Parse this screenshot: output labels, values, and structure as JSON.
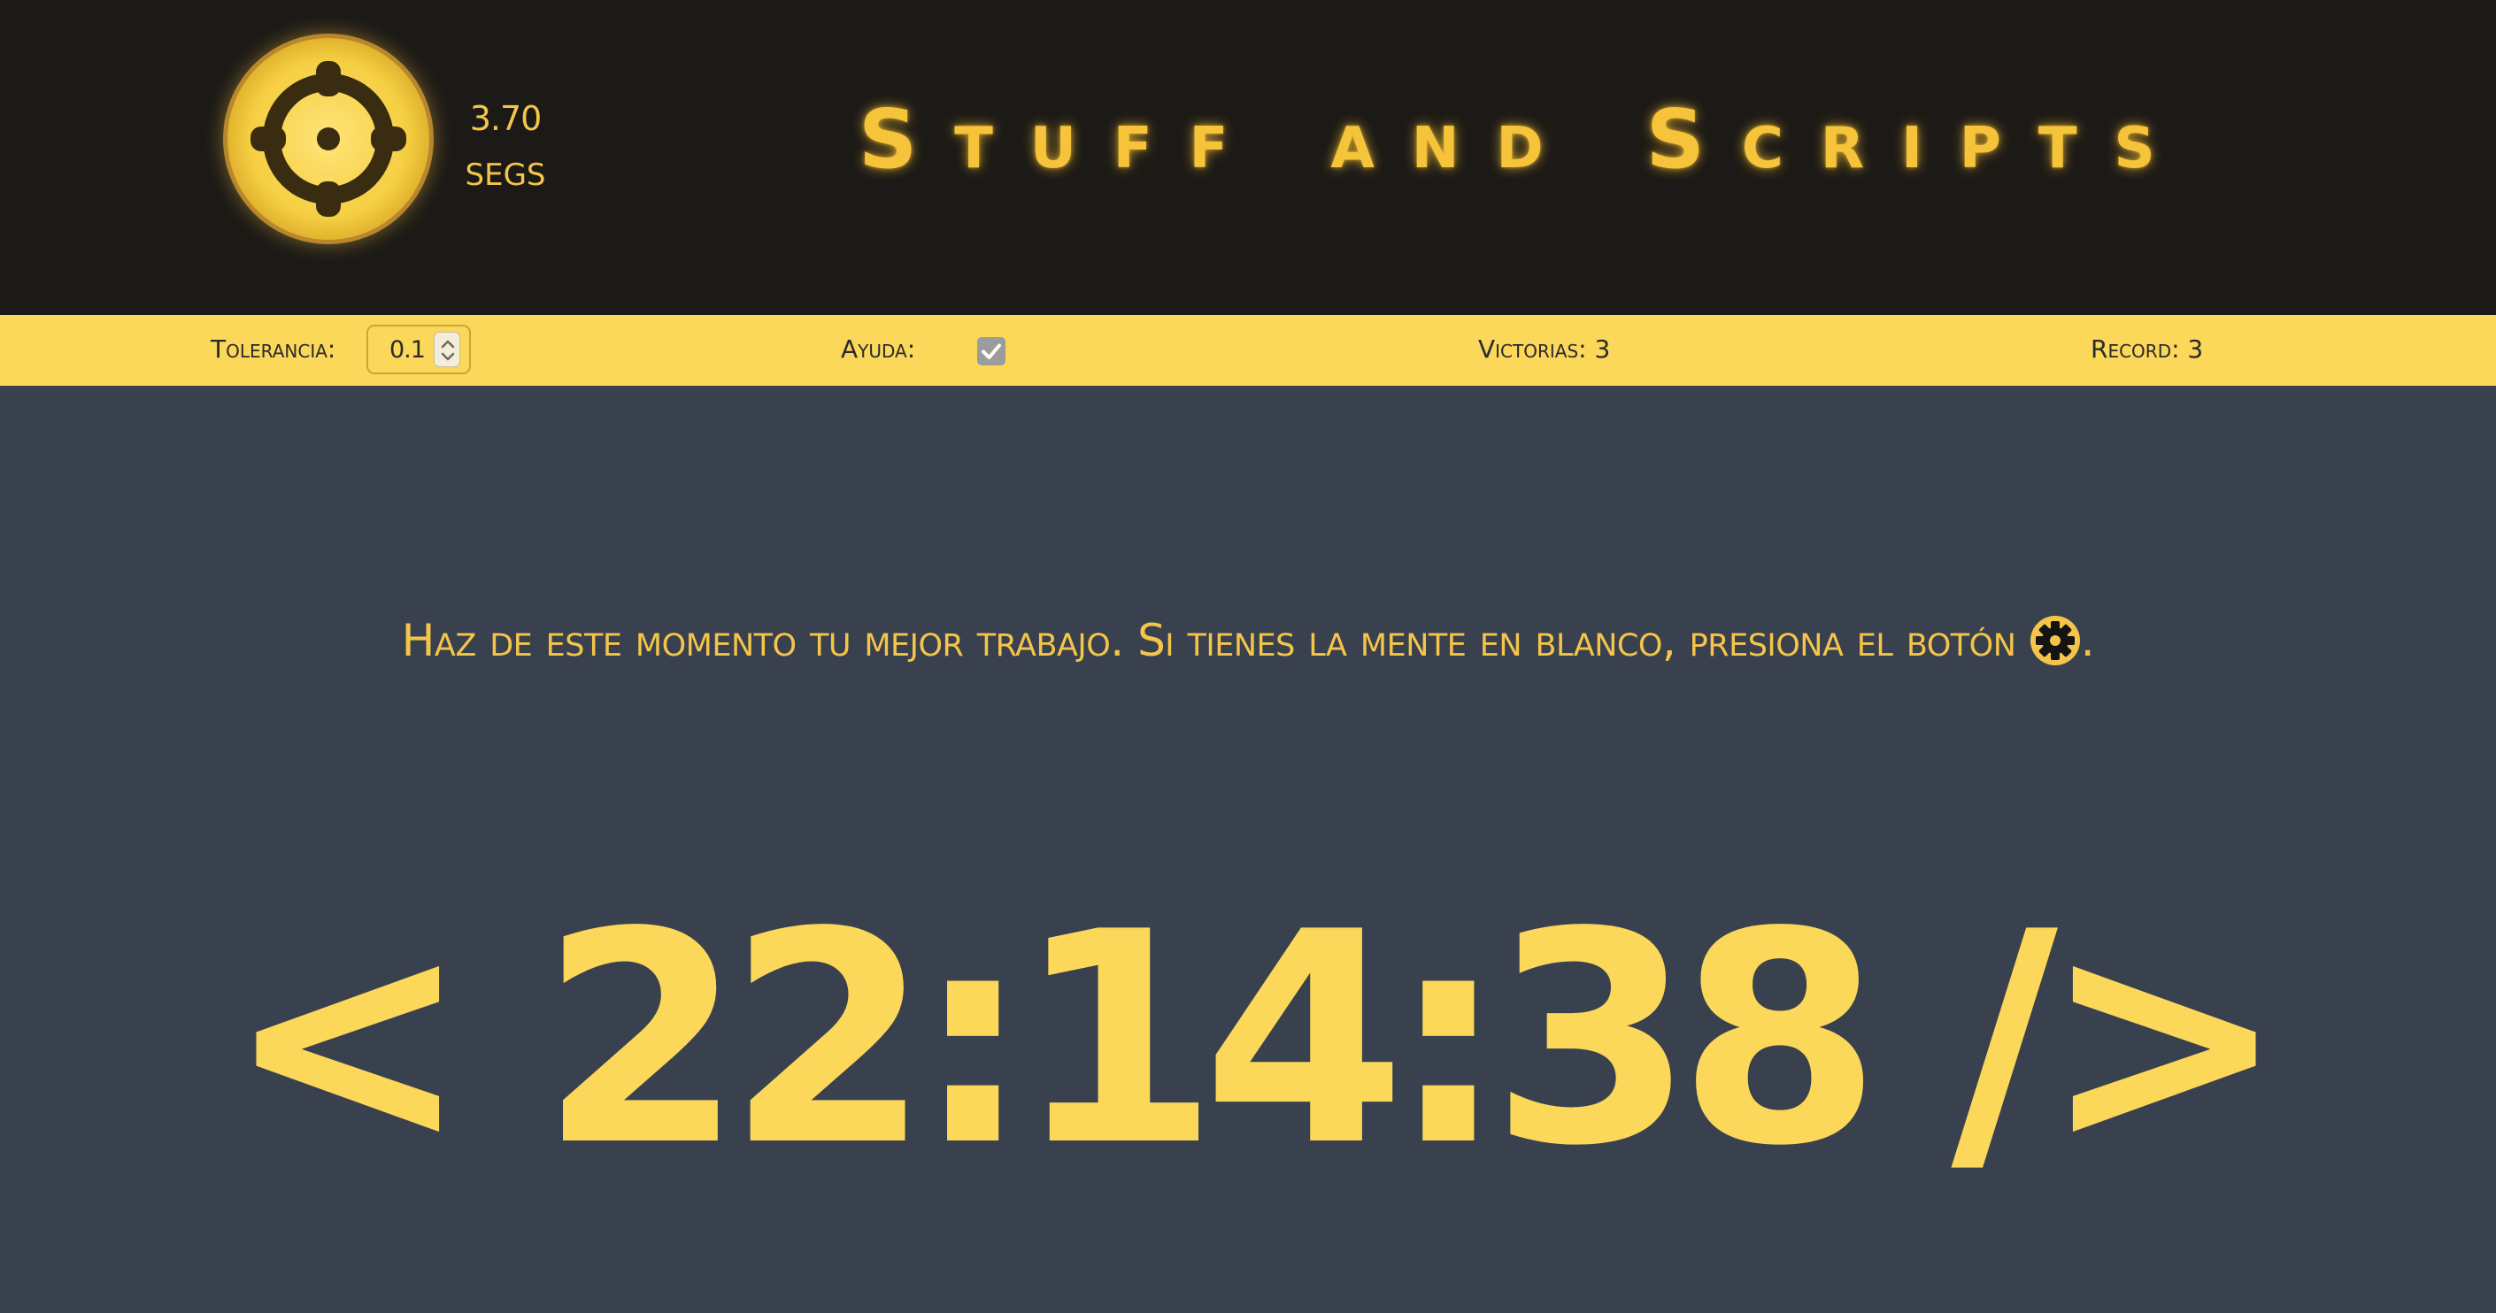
{
  "header": {
    "timer_value": "3.70",
    "timer_unit": "SEGS",
    "title": "Stuff and Scripts",
    "target_icon": "crosshair-target-icon"
  },
  "settings": {
    "tolerance_label": "Tolerancia:",
    "tolerance_value": "0.1",
    "help_label": "Ayuda:",
    "help_checked": true,
    "victories_label": "Victorias: 3",
    "record_label": "Record: 3"
  },
  "main": {
    "instruction": "Haz de este momento tu mejor trabajo. Si tienes la mente en blanco, presiona el botón",
    "instruction_end": ".",
    "gear_icon": "gear-icon",
    "clock": "< 22:14:38 />"
  },
  "colors": {
    "header_bg": "#1c1a17",
    "accent": "#f5c43a",
    "bar_bg": "#fbd75a",
    "main_bg": "#39414f"
  }
}
